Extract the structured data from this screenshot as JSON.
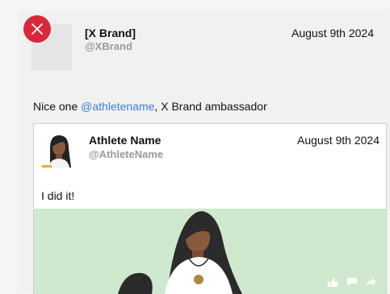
{
  "post": {
    "brand_name": "[X Brand]",
    "brand_handle": "@XBrand",
    "date": "August 9th 2024",
    "text_mention": "@athletename",
    "text_suffix": ", X Brand ambassador",
    "text_prefix": "Nice one "
  },
  "quote": {
    "name": "Athlete Name",
    "handle": "@AthleteName",
    "date": "August 9th 2024",
    "text": "I did it!"
  },
  "colors": {
    "close": "#d9283a",
    "mention": "#3b82d6",
    "media_bg": "#cfe9cf"
  },
  "icons": {
    "close": "close-icon",
    "like": "thumbs-up-icon",
    "comment": "comment-icon",
    "share": "share-arrow-icon"
  }
}
